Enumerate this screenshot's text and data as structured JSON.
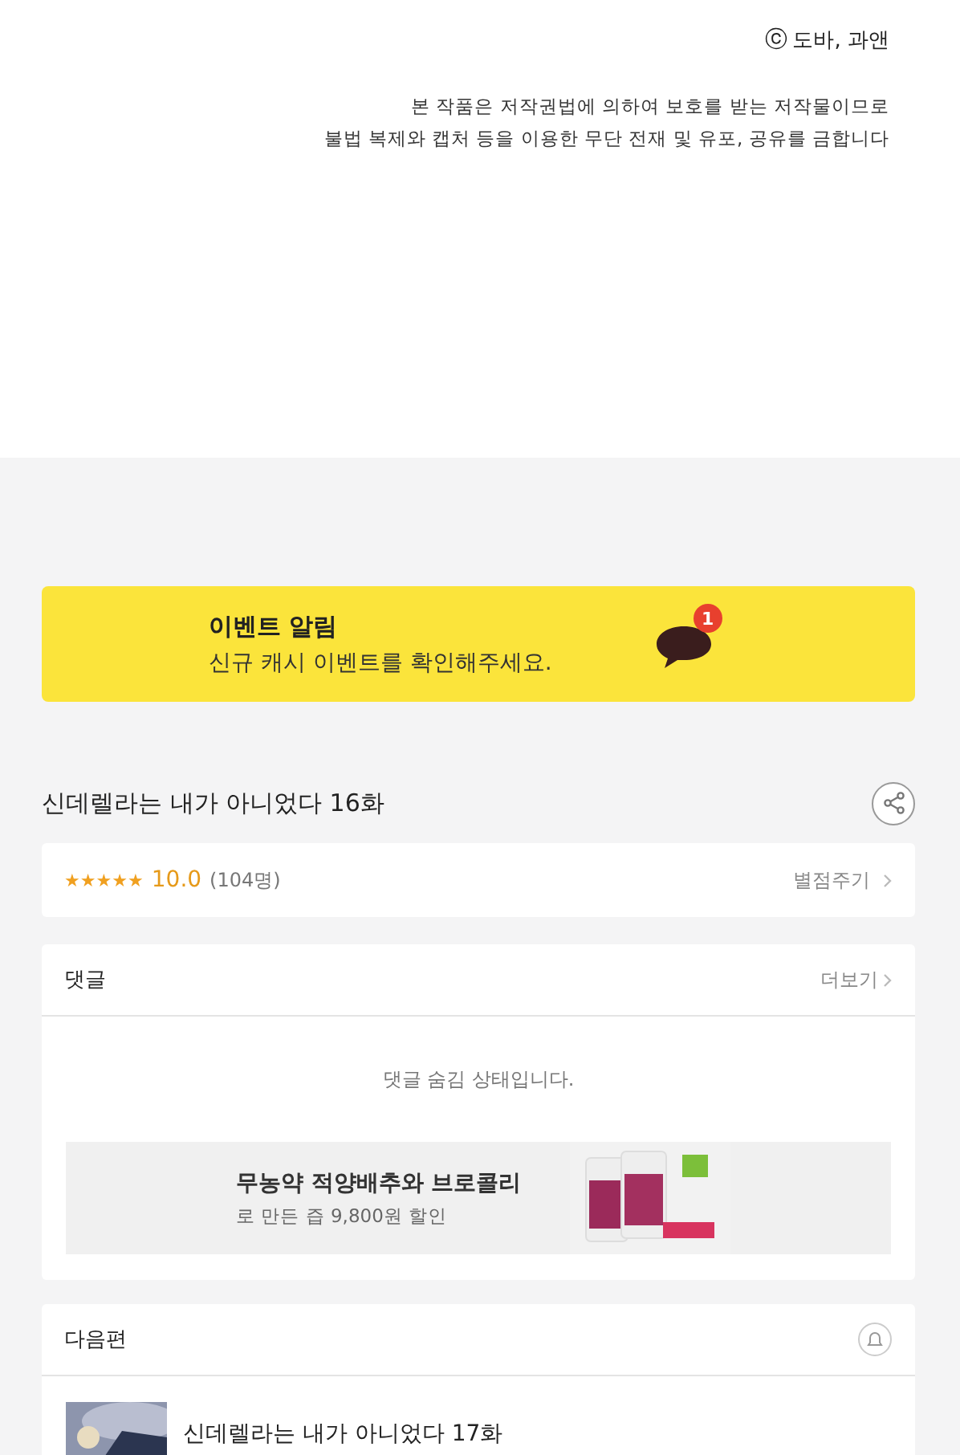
{
  "copyright": {
    "mark": "ⓒ",
    "holders": "도바, 과앤"
  },
  "notice": [
    "본 작품은 저작권법에 의하여 보호를 받는 저작물이므로",
    "불법 복제와 캡처 등을 이용한 무단 전재 및 유포, 공유를 금합니다"
  ],
  "event_banner": {
    "title": "이벤트 알림",
    "message": "신규 캐시 이벤트를 확인해주세요.",
    "badge": "1"
  },
  "episode": {
    "title": "신데렐라는 내가 아니었다 16화"
  },
  "rating": {
    "stars": 5,
    "score": "10.0",
    "count": "(104명)",
    "action": "별점주기"
  },
  "comments": {
    "heading": "댓글",
    "more": "더보기",
    "status": "댓글 숨김 상태입니다."
  },
  "ad": {
    "title": "무농약 적양배추와 브로콜리",
    "subtitle": "로 만든 즙 9,800원 할인"
  },
  "next": {
    "heading": "다음편",
    "items": [
      {
        "title": "신데렐라는 내가 아니었다 17화"
      }
    ]
  }
}
